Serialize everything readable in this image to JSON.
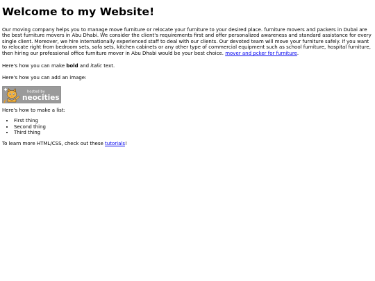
{
  "page_title": "Welcome to my Website!",
  "intro": {
    "text": "Our moving company helps you to manage move furniture or relocate your furniture to your desired place. furniture movers and packers in Dubai are the best furniture movers in Abu Dhabi. We consider the client's requirements first and offer personalized awareness and standard assistance for every single client. Moreover, we hire internationally experienced staff to deal with our clients. Our devoted team will move your furniture safely. If you want to relocate right from bedroom sets, sofa sets, kitchen cabinets or any other type of commercial equipment such as school furniture, hospital furniture, then hiring our professional office furniture mover in Abu Dhabi would be your best choice. ",
    "link_text": "mover and pcker for furniture",
    "trailing": "."
  },
  "bold_line": {
    "prefix": "Here's how you can make ",
    "bold": "bold",
    "middle": " and ",
    "italic": "italic",
    "suffix": " text."
  },
  "image_line": "Here's how you can add an image:",
  "badge": {
    "hosted_by": "hosted by",
    "brand": "neocities",
    "colors": {
      "background": "#9a9a9a",
      "text": "#ffffff",
      "cat_face": "#e39a2a"
    }
  },
  "list_line": "Here's how to make a list:",
  "list_items": [
    "First thing",
    "Second thing",
    "Third thing"
  ],
  "learn_line": {
    "prefix": "To learn more HTML/CSS, check out these ",
    "link_text": "tutorials",
    "suffix": "!"
  }
}
